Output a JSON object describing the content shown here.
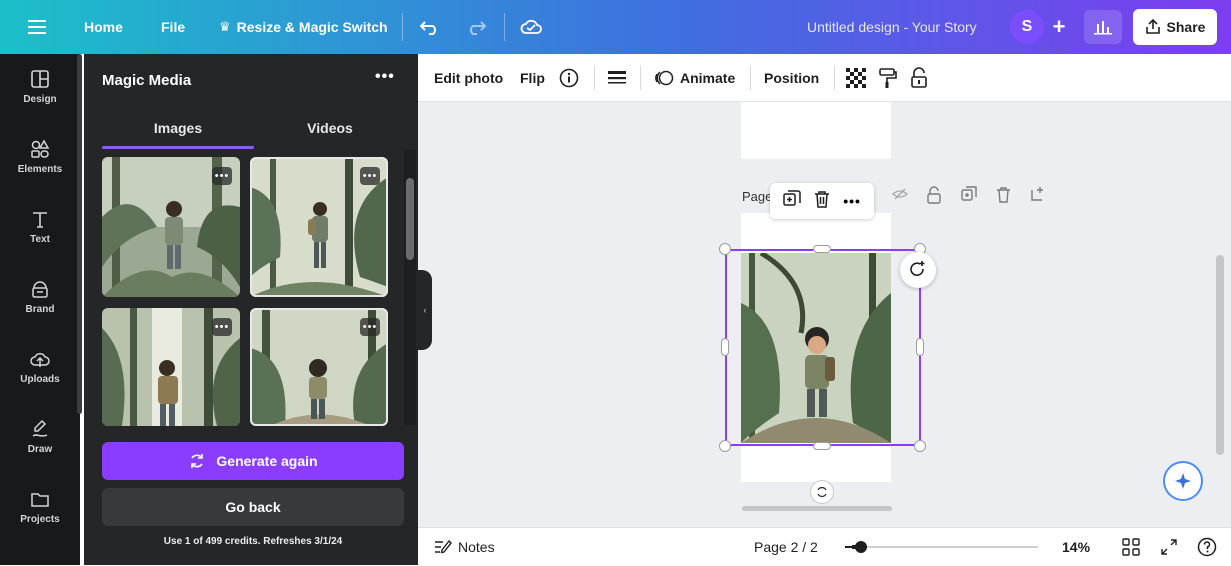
{
  "topbar": {
    "home": "Home",
    "file": "File",
    "resize": "Resize & Magic Switch",
    "doc_title": "Untitled design - Your Story",
    "avatar_initial": "S",
    "share": "Share"
  },
  "rail": {
    "items": [
      {
        "label": "Design",
        "icon": "layout-icon"
      },
      {
        "label": "Elements",
        "icon": "shapes-icon"
      },
      {
        "label": "Text",
        "icon": "text-icon"
      },
      {
        "label": "Brand",
        "icon": "brand-icon"
      },
      {
        "label": "Uploads",
        "icon": "upload-cloud-icon"
      },
      {
        "label": "Draw",
        "icon": "draw-icon"
      },
      {
        "label": "Projects",
        "icon": "folder-icon"
      }
    ]
  },
  "panel": {
    "title": "Magic Media",
    "tabs": [
      "Images",
      "Videos"
    ],
    "active_tab": "Images",
    "generate_label": "Generate again",
    "back_label": "Go back",
    "credits": "Use 1 of 499 credits. Refreshes 3/1/24"
  },
  "context_toolbar": {
    "edit_photo": "Edit photo",
    "flip": "Flip",
    "animate": "Animate",
    "position": "Position"
  },
  "canvas": {
    "page_label": "Page"
  },
  "footer": {
    "notes": "Notes",
    "page_indicator": "Page 2 / 2",
    "zoom": "14%",
    "zoom_fraction": 0.05
  },
  "colors": {
    "accent": "#8b3dff",
    "panel_bg": "#252627",
    "rail_bg": "#18191b"
  }
}
